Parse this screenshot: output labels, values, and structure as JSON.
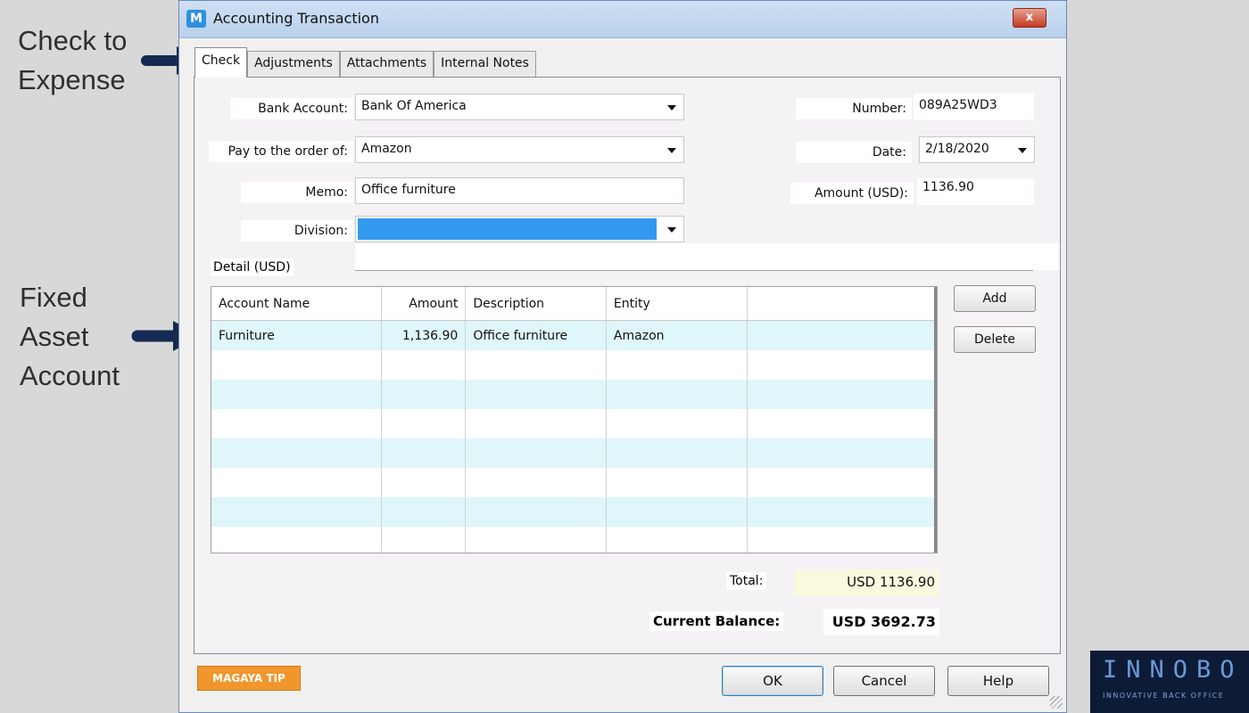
{
  "annotations": {
    "check_to_expense": [
      "Check to",
      "Expense"
    ],
    "fixed_asset": [
      "Fixed",
      "Asset",
      "Account"
    ]
  },
  "window": {
    "title": "Accounting Transaction",
    "app_icon": "M",
    "close": "x"
  },
  "tabs": [
    "Check",
    "Adjustments",
    "Attachments",
    "Internal Notes"
  ],
  "form": {
    "bank_account_label": "Bank Account:",
    "bank_account_value": "Bank Of America",
    "payee_label": "Pay to the order of:",
    "payee_value": "Amazon",
    "memo_label": "Memo:",
    "memo_value": "Office furniture",
    "division_label": "Division:",
    "division_value": "",
    "number_label": "Number:",
    "number_value": "089A25WD3",
    "date_label": "Date:",
    "date_value": "2/18/2020",
    "amount_label": "Amount (USD):",
    "amount_value": "1136.90"
  },
  "detail": {
    "label": "Detail (USD)",
    "columns": [
      "Account Name",
      "Amount",
      "Description",
      "Entity",
      ""
    ],
    "rows": [
      [
        "Furniture",
        "1,136.90",
        "Office furniture",
        "Amazon",
        ""
      ]
    ],
    "add_label": "Add",
    "delete_label": "Delete"
  },
  "totals": {
    "total_label": "Total:",
    "total_value": "USD 1136.90",
    "balance_label": "Current Balance:",
    "balance_value": "USD 3692.73"
  },
  "footer": {
    "tip": "MAGAYA TIP",
    "ok": "OK",
    "cancel": "Cancel",
    "help": "Help"
  },
  "logo": {
    "main": "INNOBO",
    "sub": "INNOVATIVE BACK OFFICE"
  },
  "colors": {
    "division_highlight": "#3399f0",
    "row_alt": "#dff6fa",
    "arrow": "#152a52",
    "tip": "#f0962c"
  }
}
